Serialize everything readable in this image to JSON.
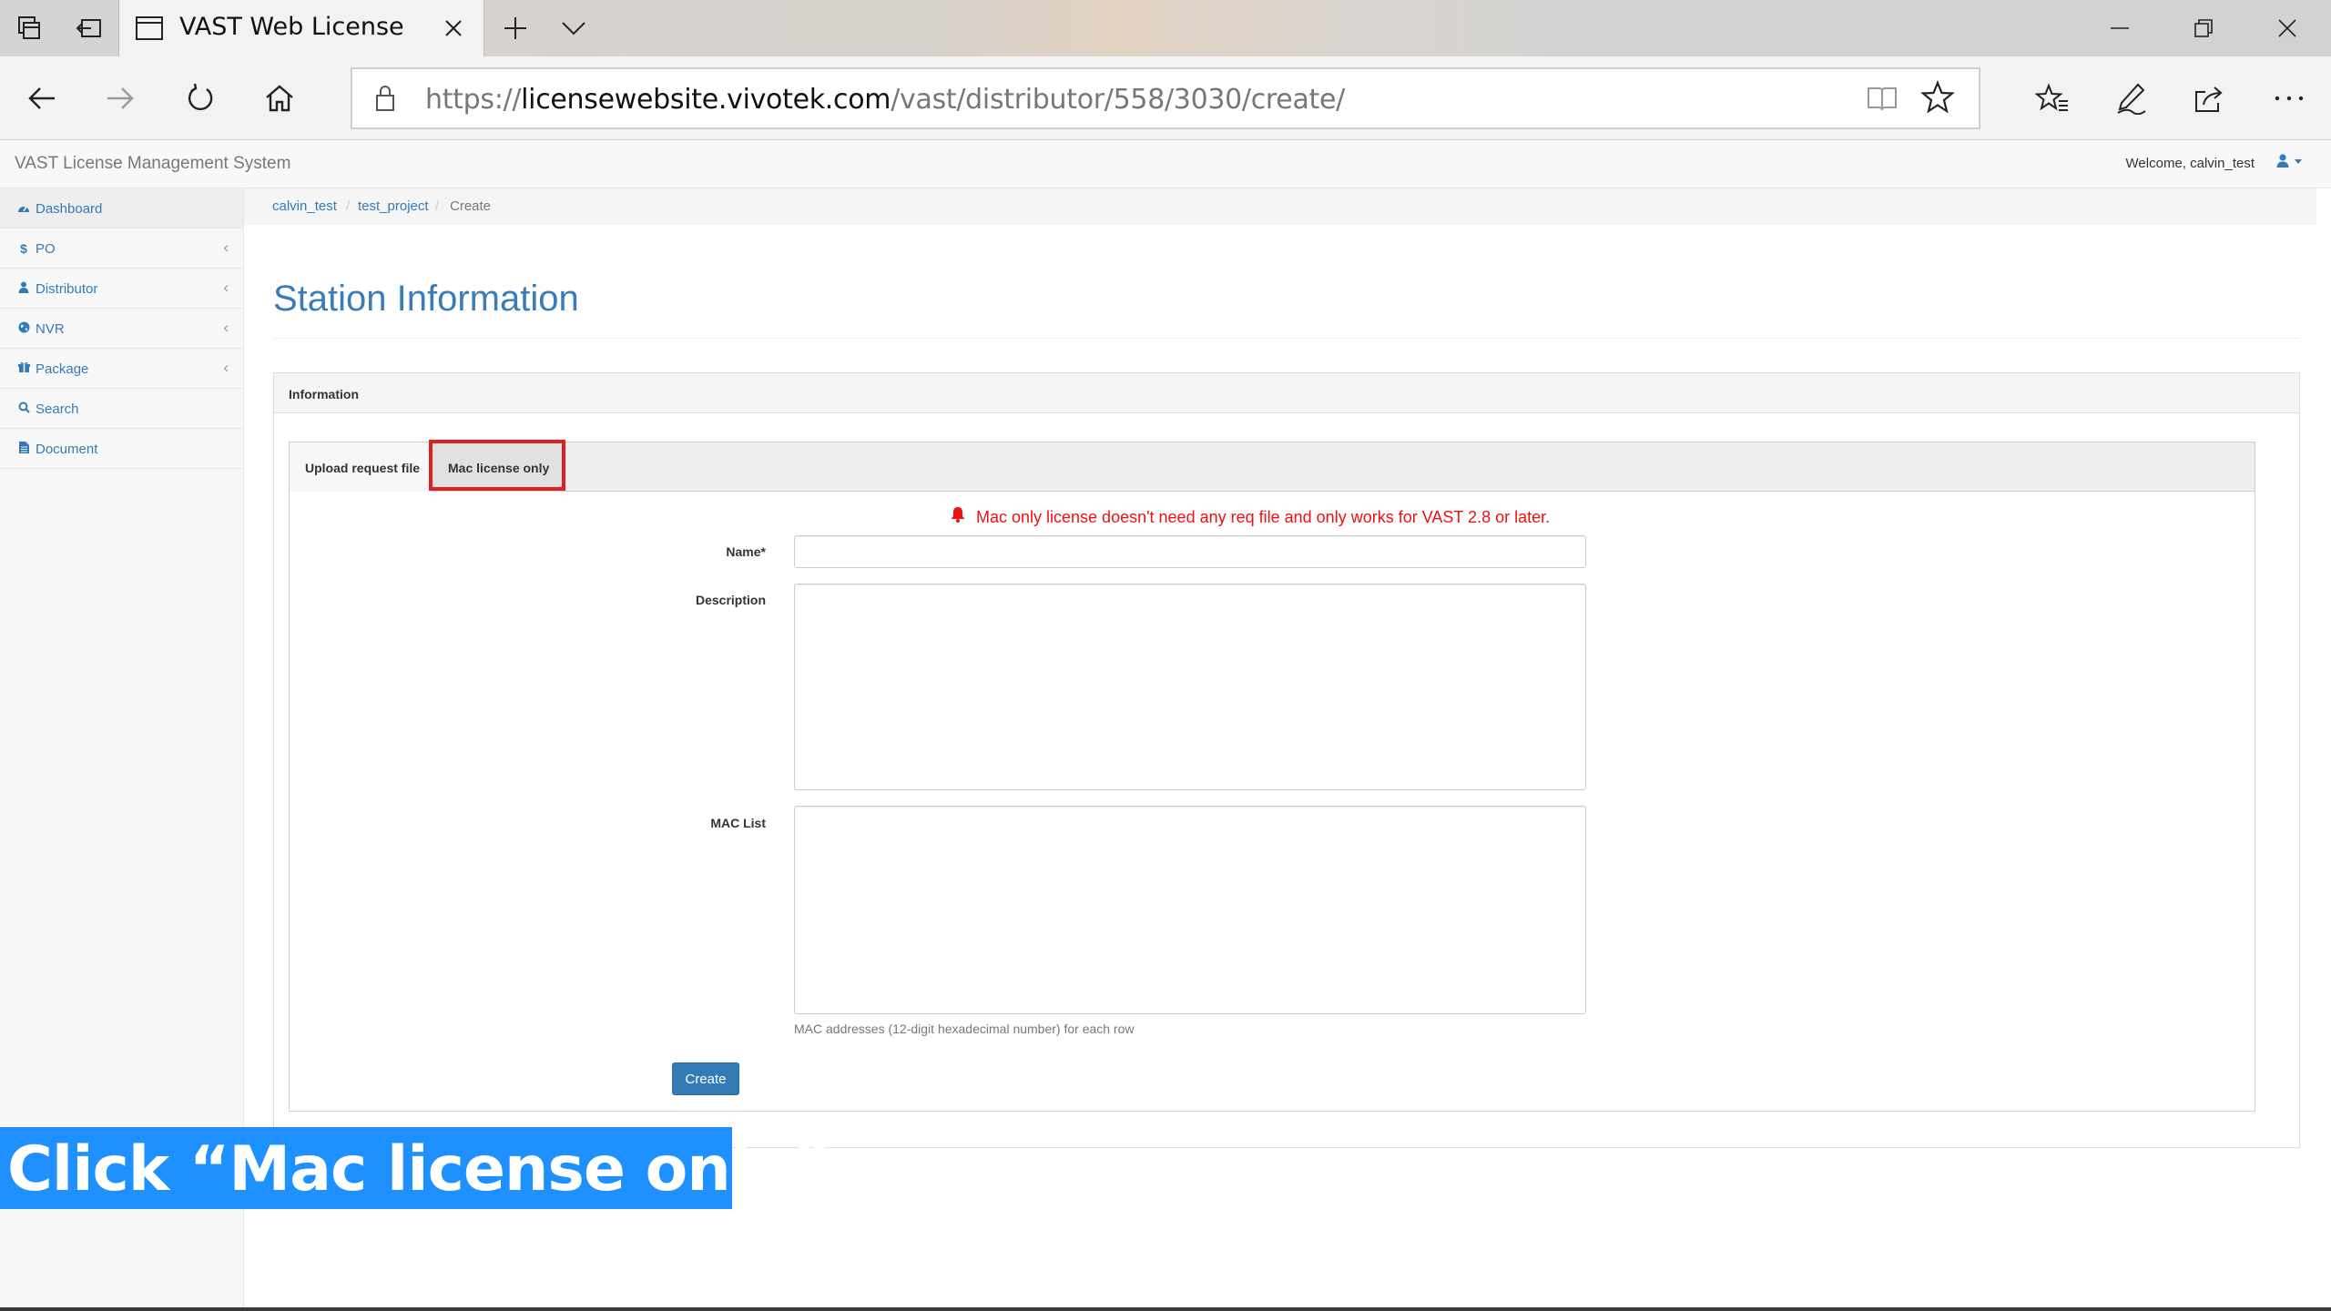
{
  "browser": {
    "tab_title": "VAST Web License - VIV",
    "url_scheme": "https://",
    "url_host": "licensewebsite.vivotek.com",
    "url_path": "/vast/distributor/558/3030/create/"
  },
  "app": {
    "brand": "VAST License Management System",
    "welcome": "Welcome, calvin_test",
    "user_menu_icon": "user-icon"
  },
  "sidebar": {
    "items": [
      {
        "label": "Dashboard",
        "icon": "dashboard-icon"
      },
      {
        "label": "PO",
        "icon": "dollar-icon"
      },
      {
        "label": "Distributor",
        "icon": "user-icon"
      },
      {
        "label": "NVR",
        "icon": "globe-icon"
      },
      {
        "label": "Package",
        "icon": "gift-icon"
      },
      {
        "label": "Search",
        "icon": "search-icon"
      },
      {
        "label": "Document",
        "icon": "document-icon"
      }
    ]
  },
  "breadcrumb": {
    "items": [
      "calvin_test",
      "test_project",
      "Create"
    ],
    "separator": "/"
  },
  "page": {
    "title": "Station Information",
    "panel_heading": "Information",
    "tabs": [
      "Upload request file",
      "Mac license only"
    ],
    "warning": "Mac only license doesn't need any req file and only works for VAST 2.8 or later.",
    "fields": {
      "name_label": "Name*",
      "description_label": "Description",
      "mac_label": "MAC List"
    },
    "mac_help": "MAC addresses (12-digit hexadecimal number) for each row",
    "create_button": "Create"
  },
  "caption": "Click “Mac license only”",
  "colors": {
    "accent": "#337ab7",
    "warning": "#ee1111",
    "caption_bg": "#1e90ff",
    "highlight": "#e02020"
  }
}
